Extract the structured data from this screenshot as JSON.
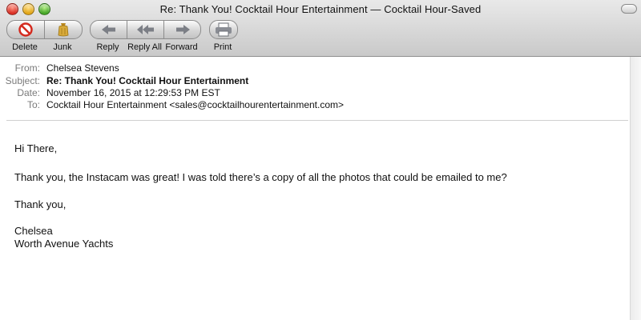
{
  "window": {
    "title": "Re: Thank You! Cocktail Hour Entertainment — Cocktail Hour-Saved"
  },
  "toolbar": {
    "delete_label": "Delete",
    "junk_label": "Junk",
    "reply_label": "Reply",
    "reply_all_label": "Reply All",
    "forward_label": "Forward",
    "print_label": "Print"
  },
  "message": {
    "headers": [
      {
        "key": "From:",
        "value": "Chelsea Stevens"
      },
      {
        "key": "Subject:",
        "value": "Re: Thank You! Cocktail Hour Entertainment"
      },
      {
        "key": "Date:",
        "value": "November 16, 2015 at 12:29:53 PM EST"
      },
      {
        "key": "To:",
        "value": "Cocktail Hour Entertainment <sales@cocktailhourentertainment.com>"
      }
    ],
    "body": [
      "Hi There,",
      "Thank you, the Instacam was great! I was told  there’s a copy of  all the photos that could be emailed to me?",
      "Thank you,",
      "Chelsea",
      "Worth Avenue Yachts"
    ]
  },
  "colors": {
    "delete_red": "#d42a1e",
    "junk_gold": "#c79b2a",
    "icon_grey": "#7c7f86"
  },
  "icons": {
    "delete": "no-entry-icon",
    "junk": "trash-bag-icon",
    "reply": "arrow-left-icon",
    "reply_all": "double-arrow-left-icon",
    "forward": "arrow-right-icon",
    "print": "printer-icon"
  }
}
